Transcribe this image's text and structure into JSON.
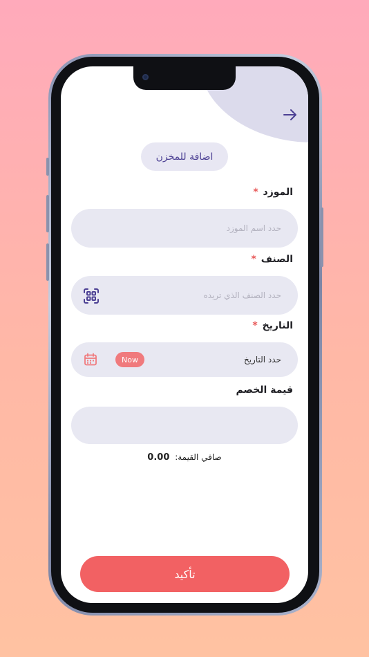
{
  "header": {
    "back_icon": "arrow-right-icon",
    "title": "اضافة للمخزن"
  },
  "form": {
    "supplier": {
      "label": "الموزد",
      "required_mark": "*",
      "placeholder": "حدد اسم الموزد"
    },
    "category": {
      "label": "الصنف",
      "required_mark": "*",
      "placeholder": "حدد الصنف الذي تريده",
      "scan_icon": "qr-scan-icon"
    },
    "date": {
      "label": "التاريخ",
      "required_mark": "*",
      "value_text": "حدد التاريخ",
      "now_label": "Now",
      "calendar_icon": "calendar-icon"
    },
    "discount": {
      "label": "قيمة الخصم",
      "value": ""
    }
  },
  "summary": {
    "net_label": "صافي القيمة:",
    "net_value": "0.00"
  },
  "actions": {
    "confirm_label": "تأكيد"
  },
  "colors": {
    "accent": "#f26163",
    "title_text": "#4b3f93",
    "field_bg": "#e8e8f2",
    "blob": "#dcdbec"
  }
}
